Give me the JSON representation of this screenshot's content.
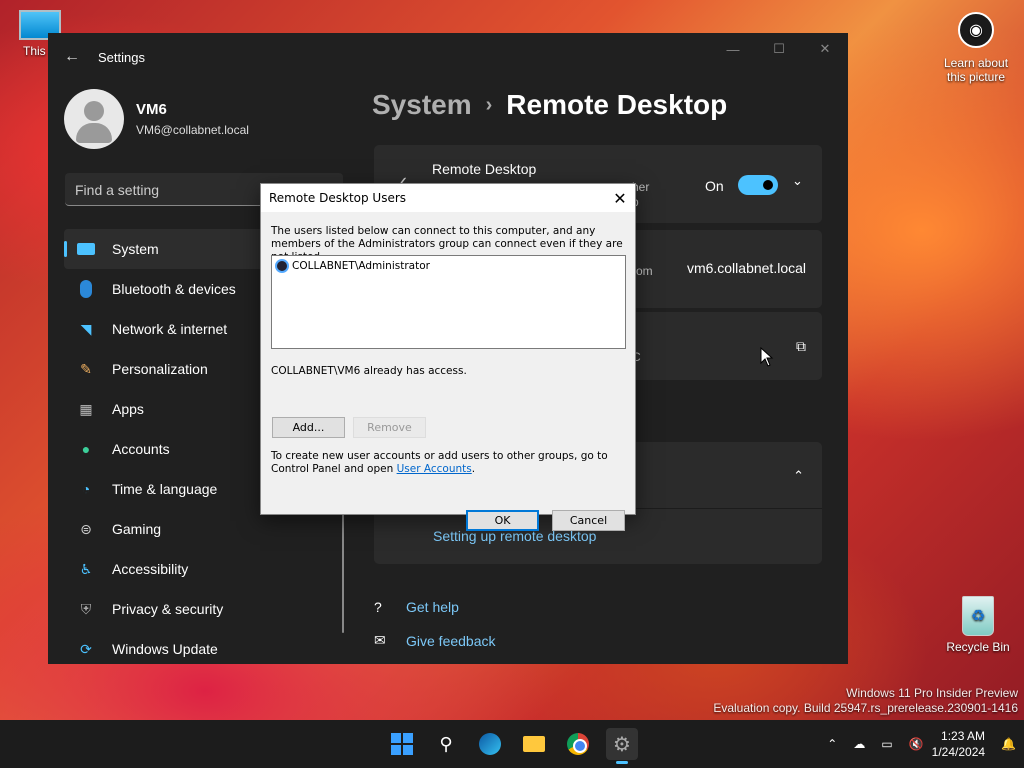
{
  "desktop": {
    "this_pc": "This P",
    "learn": "Learn about this picture",
    "recycle": "Recycle Bin",
    "watermark_line1": "Windows 11 Pro Insider Preview",
    "watermark_line2": "Evaluation copy. Build 25947.rs_prerelease.230901-1416"
  },
  "settings": {
    "title": "Settings",
    "profile_name": "VM6",
    "profile_email": "VM6@collabnet.local",
    "search_placeholder": "Find a setting",
    "nav": [
      {
        "label": "System",
        "icon": "system-icon"
      },
      {
        "label": "Bluetooth & devices",
        "icon": "bluetooth-icon"
      },
      {
        "label": "Network & internet",
        "icon": "network-icon"
      },
      {
        "label": "Personalization",
        "icon": "brush-icon"
      },
      {
        "label": "Apps",
        "icon": "apps-icon"
      },
      {
        "label": "Accounts",
        "icon": "person-icon"
      },
      {
        "label": "Time & language",
        "icon": "clock-icon"
      },
      {
        "label": "Gaming",
        "icon": "controller-icon"
      },
      {
        "label": "Accessibility",
        "icon": "accessibility-icon"
      },
      {
        "label": "Privacy & security",
        "icon": "shield-icon"
      },
      {
        "label": "Windows Update",
        "icon": "update-icon"
      }
    ],
    "breadcrumb_parent": "System",
    "breadcrumb_current": "Remote Desktop",
    "rd_label": "Remote Desktop",
    "rd_partial": "her",
    "rd_partial2": "p",
    "rd_state": "On",
    "pc_name_partial": "rom",
    "pc_name": "vm6.collabnet.local",
    "card3_partial": "C",
    "setup_link": "Setting up remote desktop",
    "get_help": "Get help",
    "give_feedback": "Give feedback"
  },
  "dialog": {
    "title": "Remote Desktop Users",
    "description": "The users listed below can connect to this computer, and any members of the Administrators group can connect even if they are not listed.",
    "users": [
      "COLLABNET\\Administrator"
    ],
    "access_note": "COLLABNET\\VM6 already has access.",
    "add_label": "Add...",
    "remove_label": "Remove",
    "info_prefix": "To create new user accounts or add users to other groups, go to Control Panel and open ",
    "info_link": "User Accounts",
    "info_suffix": ".",
    "ok_label": "OK",
    "cancel_label": "Cancel"
  },
  "taskbar": {
    "time": "1:23 AM",
    "date": "1/24/2024"
  }
}
